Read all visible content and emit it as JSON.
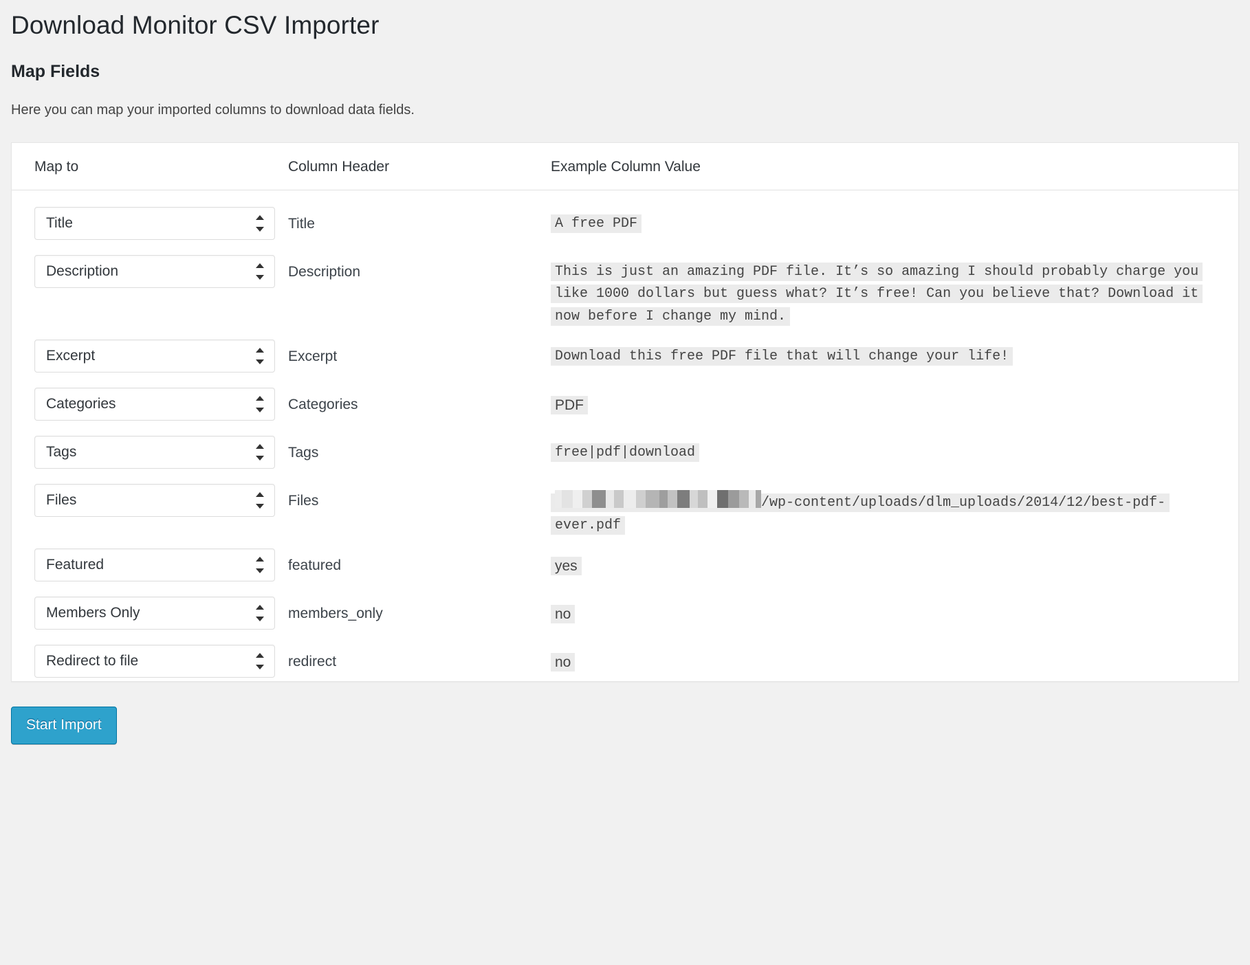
{
  "page": {
    "title": "Download Monitor CSV Importer",
    "section_title": "Map Fields",
    "intro": "Here you can map your imported columns to download data fields."
  },
  "table": {
    "headers": {
      "map_to": "Map to",
      "column_header": "Column Header",
      "example_value": "Example Column Value"
    },
    "rows": [
      {
        "map_to": "Title",
        "column_header": "Title",
        "example": "A free PDF",
        "example_style": "mono"
      },
      {
        "map_to": "Description",
        "column_header": "Description",
        "example": "This is just an amazing PDF file. It’s so amazing I should probably charge you like 1000 dollars but guess what? It’s free! Can you believe that? Download it now before I change my mind.",
        "example_style": "mono"
      },
      {
        "map_to": "Excerpt",
        "column_header": "Excerpt",
        "example": "Download this free PDF file that will change your life!",
        "example_style": "mono"
      },
      {
        "map_to": "Categories",
        "column_header": "Categories",
        "example": "PDF",
        "example_style": "sans"
      },
      {
        "map_to": "Tags",
        "column_header": "Tags",
        "example": "free|pdf|download",
        "example_style": "mono"
      },
      {
        "map_to": "Files",
        "column_header": "Files",
        "example": "/wp-content/uploads/dlm_uploads/2014/12/best-pdf-ever.pdf",
        "example_style": "mono",
        "example_redacted_prefix": true
      },
      {
        "map_to": "Featured",
        "column_header": "featured",
        "example": "yes",
        "example_style": "sans"
      },
      {
        "map_to": "Members Only",
        "column_header": "members_only",
        "example": "no",
        "example_style": "sans"
      },
      {
        "map_to": "Redirect to file",
        "column_header": "redirect",
        "example": "no",
        "example_style": "sans"
      }
    ]
  },
  "actions": {
    "start_import": "Start Import"
  },
  "colors": {
    "page_background": "#f1f1f1",
    "panel_background": "#ffffff",
    "panel_border": "#e5e5e5",
    "heading_text": "#23282d",
    "body_text": "#444444",
    "example_value_background": "#ebebeb",
    "primary_button": "#2ea2cc",
    "primary_button_border": "#0074a2"
  }
}
